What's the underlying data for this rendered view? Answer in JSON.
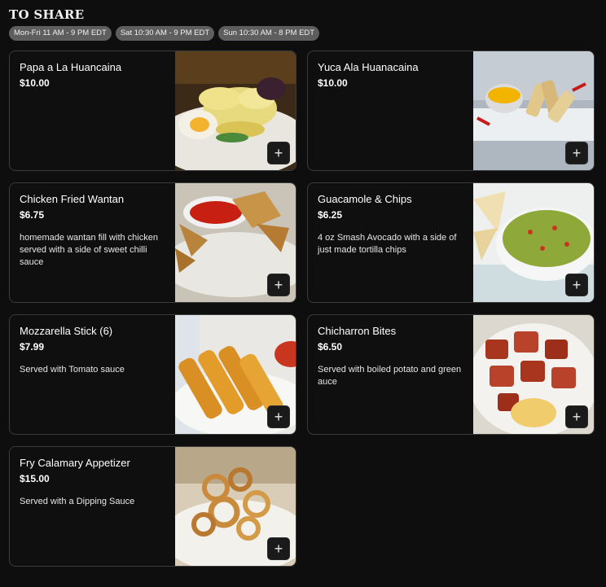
{
  "section": {
    "title": "TO SHARE",
    "hours": [
      "Mon-Fri 11 AM - 9 PM EDT",
      "Sat 10:30 AM - 9 PM EDT",
      "Sun 10:30 AM - 8 PM EDT"
    ]
  },
  "items": [
    {
      "name": "Papa a La Huancaina",
      "price": "$10.00",
      "description": "",
      "image_icon": "papa-huancaina-photo"
    },
    {
      "name": "Yuca Ala Huanacaina",
      "price": "$10.00",
      "description": "",
      "image_icon": "yuca-huancaina-photo"
    },
    {
      "name": "Chicken Fried Wantan",
      "price": "$6.75",
      "description": "homemade wantan fill with chicken served with a side of sweet chilli sauce",
      "image_icon": "wantan-photo"
    },
    {
      "name": "Guacamole & Chips",
      "price": "$6.25",
      "description": "4 oz Smash Avocado with a side of just made tortilla chips",
      "image_icon": "guacamole-photo"
    },
    {
      "name": "Mozzarella Stick (6)",
      "price": "$7.99",
      "description": "Served with Tomato sauce",
      "image_icon": "mozzarella-photo"
    },
    {
      "name": "Chicharron Bites",
      "price": "$6.50",
      "description": "Served with boiled potato and green auce",
      "image_icon": "chicharron-photo"
    },
    {
      "name": "Fry Calamary Appetizer",
      "price": "$15.00",
      "description": "Served with a Dipping Sauce",
      "image_icon": "calamari-photo"
    }
  ],
  "add_button_icon": "plus-icon",
  "add_button_glyph": "+"
}
